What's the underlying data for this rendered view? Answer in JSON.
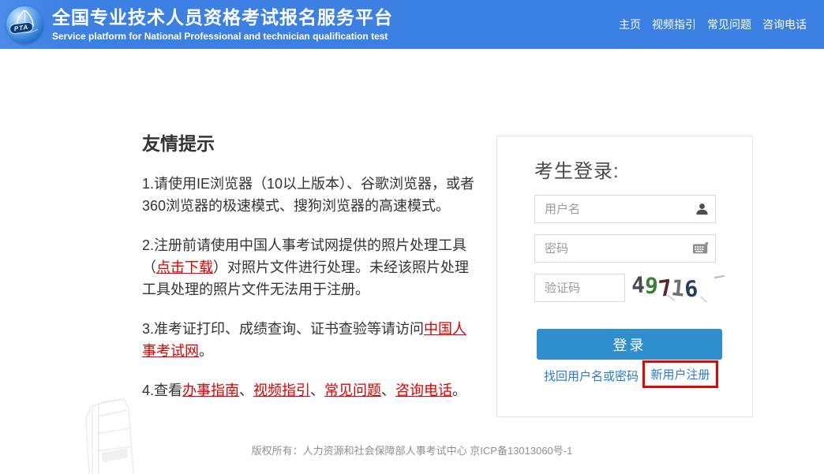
{
  "header": {
    "logo_text": "PTA",
    "title": "全国专业技术人员资格考试报名服务平台",
    "subtitle": "Service platform for National Professional and technician qualification test",
    "nav": [
      {
        "label": "主页"
      },
      {
        "label": "视频指引"
      },
      {
        "label": "常见问题"
      },
      {
        "label": "咨询电话"
      }
    ]
  },
  "tips": {
    "heading": "友情提示",
    "items": [
      {
        "segments": [
          {
            "t": "1.请使用IE浏览器（10以上版本）、谷歌浏览器，或者360浏览器的极速模式、搜狗浏览器的高速模式。"
          }
        ]
      },
      {
        "segments": [
          {
            "t": "2.注册前请使用中国人事考试网提供的照片处理工具（"
          },
          {
            "t": "点击下载",
            "link": true
          },
          {
            "t": "）对照片文件进行处理。未经该照片处理工具处理的照片文件无法用于注册。"
          }
        ]
      },
      {
        "segments": [
          {
            "t": "3.准考证打印、成绩查询、证书查验等请访问"
          },
          {
            "t": "中国人事考试网",
            "link": true
          },
          {
            "t": "。"
          }
        ]
      },
      {
        "segments": [
          {
            "t": "4.查看"
          },
          {
            "t": "办事指南",
            "link": true
          },
          {
            "t": "、"
          },
          {
            "t": "视频指引",
            "link": true
          },
          {
            "t": "、"
          },
          {
            "t": "常见问题",
            "link": true
          },
          {
            "t": "、"
          },
          {
            "t": "咨询电话",
            "link": true
          },
          {
            "t": "。"
          }
        ]
      }
    ]
  },
  "login": {
    "heading": "考生登录:",
    "username_placeholder": "用户名",
    "password_placeholder": "密码",
    "captcha_placeholder": "验证码",
    "captcha": {
      "value": "49716",
      "digits": [
        {
          "char": "4",
          "color": "#474a5a"
        },
        {
          "char": "9",
          "color": "#3e7e38"
        },
        {
          "char": "7",
          "color": "#5e2330"
        },
        {
          "char": "1",
          "color": "#70707a"
        },
        {
          "char": "6",
          "color": "#263a66"
        }
      ]
    },
    "login_button": "登录",
    "forgot_link": "找回用户名或密码",
    "register_link": "新用户注册"
  },
  "footer": {
    "text": "版权所有：人力资源和社会保障部人事考试中心 京ICP备13013060号-1"
  },
  "colors": {
    "header_bg": "#3c80e4",
    "button_bg": "#2e8ece",
    "link_blue": "#2979d0",
    "red_link": "#e00000",
    "annotation_red": "#ee0000"
  }
}
